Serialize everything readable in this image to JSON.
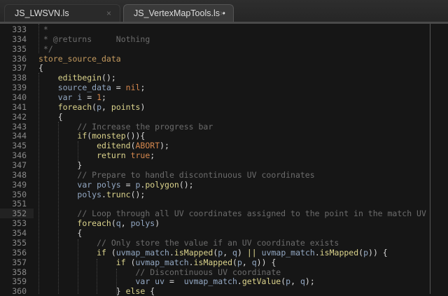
{
  "tabs": [
    {
      "label": "JS_LWSVN.ls",
      "close": "×",
      "active": false
    },
    {
      "label": "JS_VertexMapTools.ls •",
      "close": "×",
      "active": true
    }
  ],
  "current_line": "352",
  "lines": [
    {
      "n": "333",
      "t": [
        [
          "cmt",
          " *"
        ]
      ]
    },
    {
      "n": "334",
      "t": [
        [
          "cmt",
          " * @returns     Nothing"
        ]
      ]
    },
    {
      "n": "335",
      "t": [
        [
          "cmt",
          " */"
        ]
      ]
    },
    {
      "n": "336",
      "t": [
        [
          "def",
          "store_source_data"
        ]
      ]
    },
    {
      "n": "337",
      "t": [
        [
          "p",
          "{"
        ]
      ]
    },
    {
      "n": "338",
      "t": [
        [
          "p",
          "    "
        ],
        [
          "fn",
          "editbegin"
        ],
        [
          "p",
          "();"
        ]
      ]
    },
    {
      "n": "339",
      "t": [
        [
          "p",
          "    "
        ],
        [
          "id",
          "source_data"
        ],
        [
          "p",
          " = "
        ],
        [
          "num",
          "nil"
        ],
        [
          "p",
          ";"
        ]
      ]
    },
    {
      "n": "340",
      "t": [
        [
          "p",
          "    "
        ],
        [
          "id",
          "var i"
        ],
        [
          "p",
          " = "
        ],
        [
          "num",
          "1"
        ],
        [
          "p",
          ";"
        ]
      ]
    },
    {
      "n": "341",
      "t": [
        [
          "p",
          "    "
        ],
        [
          "kw",
          "foreach"
        ],
        [
          "p",
          "("
        ],
        [
          "id",
          "p"
        ],
        [
          "p",
          ", "
        ],
        [
          "fn",
          "points"
        ],
        [
          "p",
          ")"
        ]
      ]
    },
    {
      "n": "342",
      "t": [
        [
          "p",
          "    {"
        ]
      ]
    },
    {
      "n": "343",
      "t": [
        [
          "p",
          "        "
        ],
        [
          "cmt",
          "// Increase the progress bar"
        ]
      ]
    },
    {
      "n": "344",
      "t": [
        [
          "p",
          "        "
        ],
        [
          "kw",
          "if"
        ],
        [
          "p",
          "("
        ],
        [
          "fn",
          "monstep"
        ],
        [
          "p",
          "()){"
        ]
      ]
    },
    {
      "n": "345",
      "t": [
        [
          "p",
          "            "
        ],
        [
          "fn",
          "editend"
        ],
        [
          "p",
          "("
        ],
        [
          "num",
          "ABORT"
        ],
        [
          "p",
          ");"
        ]
      ]
    },
    {
      "n": "346",
      "t": [
        [
          "p",
          "            "
        ],
        [
          "kw",
          "return"
        ],
        [
          "p",
          " "
        ],
        [
          "num",
          "true"
        ],
        [
          "p",
          ";"
        ]
      ]
    },
    {
      "n": "347",
      "t": [
        [
          "p",
          "        }"
        ]
      ]
    },
    {
      "n": "348",
      "t": [
        [
          "p",
          "        "
        ],
        [
          "cmt",
          "// Prepare to handle discontinuous UV coordinates"
        ]
      ]
    },
    {
      "n": "349",
      "t": [
        [
          "p",
          "        "
        ],
        [
          "id",
          "var polys"
        ],
        [
          "p",
          " = "
        ],
        [
          "id",
          "p"
        ],
        [
          "p",
          "."
        ],
        [
          "fn",
          "polygon"
        ],
        [
          "p",
          "();"
        ]
      ]
    },
    {
      "n": "350",
      "t": [
        [
          "p",
          "        "
        ],
        [
          "id",
          "polys"
        ],
        [
          "p",
          "."
        ],
        [
          "fn",
          "trunc"
        ],
        [
          "p",
          "();"
        ]
      ]
    },
    {
      "n": "351",
      "t": [
        [
          "p",
          ""
        ]
      ]
    },
    {
      "n": "352",
      "t": [
        [
          "p",
          "        "
        ],
        [
          "cmt",
          "// Loop through all UV coordinates assigned to the point in the match UV"
        ]
      ]
    },
    {
      "n": "353",
      "t": [
        [
          "p",
          "        "
        ],
        [
          "kw",
          "foreach"
        ],
        [
          "p",
          "("
        ],
        [
          "id",
          "q"
        ],
        [
          "p",
          ", "
        ],
        [
          "id",
          "polys"
        ],
        [
          "p",
          ")"
        ]
      ]
    },
    {
      "n": "354",
      "t": [
        [
          "p",
          "        {"
        ]
      ]
    },
    {
      "n": "355",
      "t": [
        [
          "p",
          "            "
        ],
        [
          "cmt",
          "// Only store the value if an UV coordinate exists"
        ]
      ]
    },
    {
      "n": "356",
      "t": [
        [
          "p",
          "            "
        ],
        [
          "kw",
          "if"
        ],
        [
          "p",
          " ("
        ],
        [
          "id",
          "uvmap_match"
        ],
        [
          "p",
          "."
        ],
        [
          "fn",
          "isMapped"
        ],
        [
          "p",
          "("
        ],
        [
          "id",
          "p"
        ],
        [
          "p",
          ", "
        ],
        [
          "id",
          "q"
        ],
        [
          "p",
          ") "
        ],
        [
          "kw",
          "||"
        ],
        [
          "p",
          " "
        ],
        [
          "id",
          "uvmap_match"
        ],
        [
          "p",
          "."
        ],
        [
          "fn",
          "isMapped"
        ],
        [
          "p",
          "("
        ],
        [
          "id",
          "p"
        ],
        [
          "p",
          ")) {"
        ]
      ]
    },
    {
      "n": "357",
      "t": [
        [
          "p",
          "                "
        ],
        [
          "kw",
          "if"
        ],
        [
          "p",
          " ("
        ],
        [
          "id",
          "uvmap_match"
        ],
        [
          "p",
          "."
        ],
        [
          "fn",
          "isMapped"
        ],
        [
          "p",
          "("
        ],
        [
          "id",
          "p"
        ],
        [
          "p",
          ", "
        ],
        [
          "id",
          "q"
        ],
        [
          "p",
          ")) {"
        ]
      ]
    },
    {
      "n": "358",
      "t": [
        [
          "p",
          "                    "
        ],
        [
          "cmt",
          "// Discontinuous UV coordinate"
        ]
      ]
    },
    {
      "n": "359",
      "t": [
        [
          "p",
          "                    "
        ],
        [
          "id",
          "var uv"
        ],
        [
          "p",
          " =  "
        ],
        [
          "id",
          "uvmap_match"
        ],
        [
          "p",
          "."
        ],
        [
          "fn",
          "getValue"
        ],
        [
          "p",
          "("
        ],
        [
          "id",
          "p"
        ],
        [
          "p",
          ", "
        ],
        [
          "id",
          "q"
        ],
        [
          "p",
          ");"
        ]
      ]
    },
    {
      "n": "360",
      "t": [
        [
          "p",
          "                } "
        ],
        [
          "kw",
          "else"
        ],
        [
          "p",
          " {"
        ]
      ]
    }
  ]
}
